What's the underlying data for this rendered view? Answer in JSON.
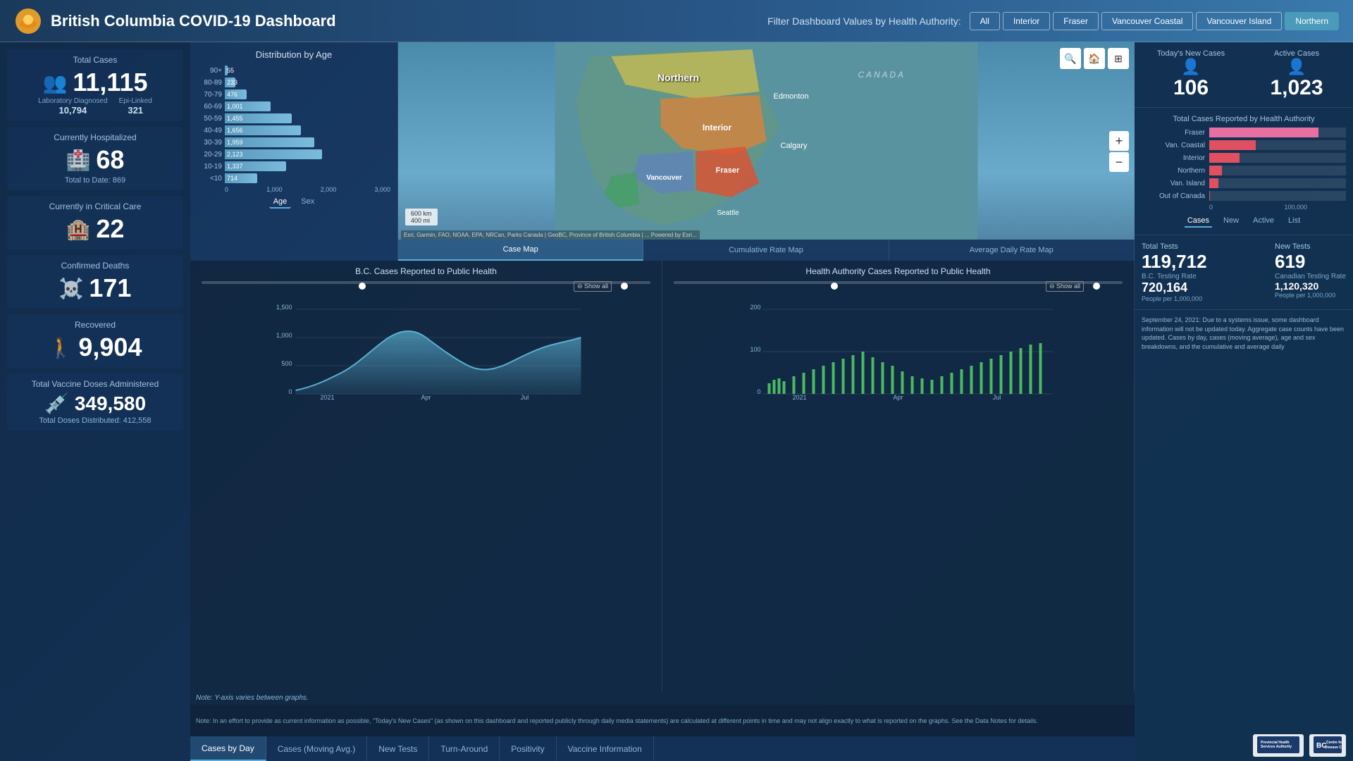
{
  "header": {
    "title": "British Columbia COVID-19 Dashboard",
    "filter_label": "Filter Dashboard Values by Health Authority:",
    "filters": [
      "All",
      "Interior",
      "Fraser",
      "Vancouver Coastal",
      "Vancouver Island",
      "Northern"
    ],
    "active_filter": "Northern"
  },
  "left_panel": {
    "total_cases": {
      "title": "Total Cases",
      "value": "11,115",
      "lab_diagnosed_label": "Laboratory Diagnosed",
      "lab_diagnosed_val": "10,794",
      "epi_linked_label": "Epi-Linked",
      "epi_linked_val": "321"
    },
    "hospitalized": {
      "title": "Currently Hospitalized",
      "value": "68",
      "sub": "Total to Date: 869"
    },
    "critical_care": {
      "title": "Currently in Critical Care",
      "value": "22"
    },
    "confirmed_deaths": {
      "title": "Confirmed Deaths",
      "value": "171"
    },
    "recovered": {
      "title": "Recovered",
      "value": "9,904"
    },
    "vaccine": {
      "title": "Total Vaccine Doses Administered",
      "value": "349,580",
      "sub": "Total Doses Distributed: 412,558"
    }
  },
  "age_chart": {
    "title": "Distribution by Age",
    "bars": [
      {
        "label": "90+",
        "value": 55,
        "max": 3000
      },
      {
        "label": "80-89",
        "value": 233,
        "max": 3000
      },
      {
        "label": "70-79",
        "value": 476,
        "max": 3000
      },
      {
        "label": "60-69",
        "value": 1001,
        "max": 3000
      },
      {
        "label": "50-59",
        "value": 1455,
        "max": 3000
      },
      {
        "label": "40-49",
        "value": 1656,
        "max": 3000
      },
      {
        "label": "30-39",
        "value": 1959,
        "max": 3000
      },
      {
        "label": "20-29",
        "value": 2123,
        "max": 3000
      },
      {
        "label": "10-19",
        "value": 1337,
        "max": 3000
      },
      {
        "label": "<10",
        "value": 714,
        "max": 3000
      }
    ],
    "x_axis": [
      "0",
      "1,000",
      "2,000",
      "3,000"
    ],
    "tabs": [
      "Age",
      "Sex"
    ]
  },
  "map": {
    "regions": [
      "Northern",
      "Interior",
      "Fraser",
      "Vancouver",
      "Seattle"
    ],
    "tabs": [
      "Case Map",
      "Cumulative Rate Map",
      "Average Daily Rate Map"
    ]
  },
  "ha_chart": {
    "title": "Total Cases Reported by Health Authority",
    "bars": [
      {
        "label": "Fraser",
        "value": 95.8,
        "display": "95,8",
        "color": "#e05060",
        "max": 100000
      },
      {
        "label": "Van. Coastal",
        "value": 40.862,
        "display": "40,862",
        "color": "#e05060",
        "max": 100000
      },
      {
        "label": "Interior",
        "value": 26.3,
        "display": "26,300",
        "color": "#e05060",
        "max": 100000
      },
      {
        "label": "Northern",
        "value": 11.115,
        "display": "11,115",
        "color": "#e05060",
        "max": 100000
      },
      {
        "label": "Van. Island",
        "value": 8.163,
        "display": "8,163",
        "color": "#e05060",
        "max": 100000
      },
      {
        "label": "Out of Canada",
        "value": 0.279,
        "display": "279",
        "color": "#e05060",
        "max": 100000
      }
    ],
    "x_axis": [
      "0",
      "100,000"
    ],
    "tabs": [
      "Cases",
      "New",
      "Active",
      "List"
    ]
  },
  "right_stats": {
    "new_cases": {
      "label": "Today's New Cases",
      "value": "106"
    },
    "active_cases": {
      "label": "Active Cases",
      "value": "1,023"
    }
  },
  "tests": {
    "title": "Total Tests",
    "total": "119,712",
    "new_tests_label": "New Tests",
    "new_tests": "619",
    "bc_rate_label": "B.C. Testing Rate",
    "bc_rate": "720,164",
    "bc_rate_sub": "People per 1,000,000",
    "canada_rate_label": "Canadian Testing Rate",
    "canada_rate": "1,120,320",
    "canada_rate_sub": "People per 1,000,000"
  },
  "notice": "September 24, 2021: Due to a systems issue, some dashboard information will not be updated today. Aggregate case counts have been updated. Cases by day, cases (moving average), age and sex breakdowns, and the cumulative and average daily",
  "charts_bottom": {
    "bc_cases_title": "B.C. Cases Reported to Public Health",
    "ha_cases_title": "Health Authority Cases Reported to Public Health",
    "y_axis_bc": [
      "0",
      "500",
      "1,000",
      "1,500"
    ],
    "y_axis_ha": [
      "0",
      "100",
      "200"
    ],
    "x_axis": [
      "2021",
      "Apr",
      "Jul"
    ],
    "note": "Note: Y-axis varies between graphs.",
    "bottom_note": "Note: In an effort to provide as current information as possible, \"Today's New Cases\" (as shown on this dashboard and reported publicly through daily media statements) are calculated at different points in time and may not align exactly to what is reported on the graphs. See the Data Notes for details.",
    "tabs": [
      "Cases by Day",
      "Cases (Moving Avg.)",
      "New Tests",
      "Turn-Around",
      "Positivity",
      "Vaccine Information"
    ]
  }
}
